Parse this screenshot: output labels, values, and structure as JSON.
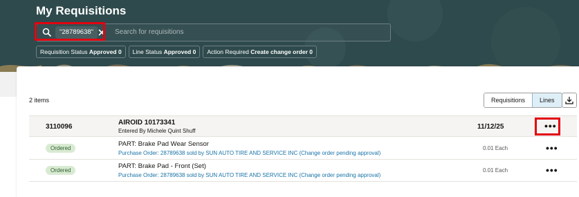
{
  "header": {
    "title": "My Requisitions"
  },
  "search": {
    "chip_value": "\"28789638\"",
    "placeholder": "Search for requisitions"
  },
  "filters": [
    {
      "label": "Requisition Status",
      "value": "Approved",
      "count": "0"
    },
    {
      "label": "Line Status",
      "value": "Approved",
      "count": "0"
    },
    {
      "label": "Action Required",
      "value": "Create change order",
      "count": "0"
    }
  ],
  "results": {
    "count_label": "2 items",
    "view_requisitions": "Requisitions",
    "view_lines": "Lines"
  },
  "requisition": {
    "number": "3110096",
    "title": "AIROID 10173341",
    "entered_by": "Entered By Michele Quint Shuff",
    "date": "11/12/25",
    "actions": "•••"
  },
  "lines": [
    {
      "status": "Ordered",
      "title": "PART: Brake Pad Wear Sensor",
      "po_text": "Purchase Order: 28789638 sold by SUN AUTO TIRE AND SERVICE INC (Change order pending approval)",
      "qty": "0.01 Each",
      "actions": "•••"
    },
    {
      "status": "Ordered",
      "title": "PART: Brake Pad - Front (Set)",
      "po_text": "Purchase Order: 28789638 sold by SUN AUTO TIRE AND SERVICE INC (Change order pending approval)",
      "qty": "0.01 Each",
      "actions": "•••"
    }
  ],
  "icons": {
    "search": "search-icon",
    "clear": "close-icon",
    "download": "download-icon",
    "more": "more-actions-icon"
  },
  "colors": {
    "header_bg": "#2f4a4d",
    "highlight": "#e3000f",
    "link": "#1a73a8",
    "badge_bg": "#d9ead3"
  }
}
